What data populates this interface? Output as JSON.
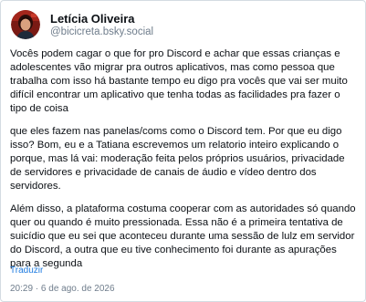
{
  "author": {
    "display_name": "Letícia Oliveira",
    "handle": "@bicicreta.bsky.social",
    "avatar_icon": "avatar-photo-icon"
  },
  "post": {
    "paragraphs": [
      "Vocês podem cagar o que for pro Discord e achar que essas crianças e adolescentes vão migrar pra outros aplicativos, mas como pessoa que trabalha com isso há bastante tempo eu digo pra vocês que vai ser muito difícil encontrar um aplicativo que tenha todas as facilidades pra fazer o tipo de coisa",
      "que eles fazem nas panelas/coms como o Discord tem. Por que eu digo isso? Bom, eu e a Tatiana escrevemos um relatorio inteiro explicando o porque, mas lá vai: moderação feita pelos próprios usuários, privacidade de servidores e privacidade de canais de áudio e vídeo dentro dos servidores.",
      "Além disso, a plataforma costuma cooperar com as autoridades só quando quer ou quando é muito pressionada. Essa não é a primeira tentativa de suicídio que eu sei que aconteceu durante uma sessão de lulz em servidor do Discord, a outra que eu tive conhecimento foi durante as apurações para a segunda"
    ],
    "translate_label": "Traduzir",
    "timestamp": "20:29 · 6 de ago. de 2026"
  },
  "colors": {
    "text": "#0b0f14",
    "muted": "#6f7d8c",
    "link": "#1d7be0",
    "border": "#d4dbe2"
  }
}
